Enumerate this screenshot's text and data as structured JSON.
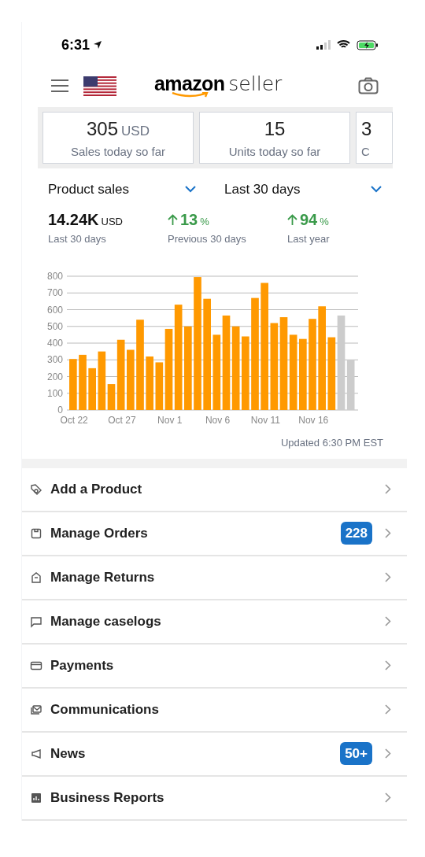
{
  "status_bar": {
    "time": "6:31"
  },
  "header": {
    "logo_bold": "amazon",
    "logo_light": "seller"
  },
  "stat_cards": [
    {
      "value": "305",
      "unit": "USD",
      "label": "Sales today so far"
    },
    {
      "value": "15",
      "label": "Units today so far"
    },
    {
      "value": "3",
      "label": "C"
    }
  ],
  "selectors": [
    {
      "label": "Product sales"
    },
    {
      "label": "Last 30 days"
    }
  ],
  "metrics": [
    {
      "kind": "total",
      "value": "14.24K",
      "unit": "USD",
      "label": "Last 30 days"
    },
    {
      "kind": "change",
      "value": "13",
      "unit": "%",
      "label": "Previous 30 days"
    },
    {
      "kind": "change",
      "value": "94",
      "unit": "%",
      "label": "Last year"
    }
  ],
  "chart_data": {
    "type": "bar",
    "grid": true,
    "categories": [
      "Oct 22",
      null,
      null,
      null,
      null,
      "Oct 27",
      null,
      null,
      null,
      null,
      "Nov 1",
      null,
      null,
      null,
      null,
      "Nov 6",
      null,
      null,
      null,
      null,
      "Nov 11",
      null,
      null,
      null,
      null,
      "Nov 16",
      null,
      null,
      null,
      null
    ],
    "yticks": [
      0,
      100,
      200,
      300,
      400,
      500,
      600,
      700,
      800
    ],
    "ylim": [
      0,
      800
    ],
    "series": [
      {
        "color": "#ff9900",
        "values": [
          305,
          330,
          250,
          350,
          155,
          420,
          360,
          540,
          320,
          285,
          485,
          630,
          500,
          795,
          665,
          450,
          565,
          500,
          440,
          670,
          760,
          520,
          555,
          450,
          425,
          545,
          620,
          435,
          null,
          null
        ]
      },
      {
        "color": "#cccccc",
        "values": [
          null,
          null,
          null,
          null,
          null,
          null,
          null,
          null,
          null,
          null,
          null,
          null,
          null,
          null,
          null,
          null,
          null,
          null,
          null,
          null,
          null,
          null,
          null,
          null,
          null,
          null,
          null,
          null,
          565,
          300
        ]
      }
    ]
  },
  "updated": "Updated 6:30 PM EST",
  "menu": [
    {
      "kind": "tag",
      "label": "Add a Product"
    },
    {
      "kind": "box",
      "label": "Manage Orders",
      "badge": "228"
    },
    {
      "kind": "return",
      "label": "Manage Returns"
    },
    {
      "kind": "chat",
      "label": "Manage caselogs"
    },
    {
      "kind": "card",
      "label": "Payments"
    },
    {
      "kind": "mail",
      "label": "Communications"
    },
    {
      "kind": "megaphone",
      "label": "News",
      "badge": "50+"
    },
    {
      "kind": "report",
      "label": "Business Reports"
    }
  ]
}
